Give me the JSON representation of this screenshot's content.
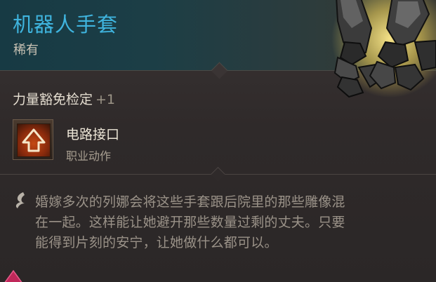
{
  "item": {
    "name": "机器人手套",
    "rarity": "稀有",
    "name_color": "#3fb4de"
  },
  "stat": {
    "label": "力量豁免检定",
    "bonus": "+1"
  },
  "action": {
    "name": "电路接口",
    "type": "职业动作",
    "icon": "arrow-up-icon"
  },
  "lore": {
    "lines": [
      "婚嫁多次的列娜会将这些手套跟后院里的那些雕像混",
      "在一起。这样能让她避开那些数量过剩的丈夫。只要",
      "能得到片刻的安宁，让她做什么都可以。"
    ],
    "icon": "quill-icon"
  }
}
